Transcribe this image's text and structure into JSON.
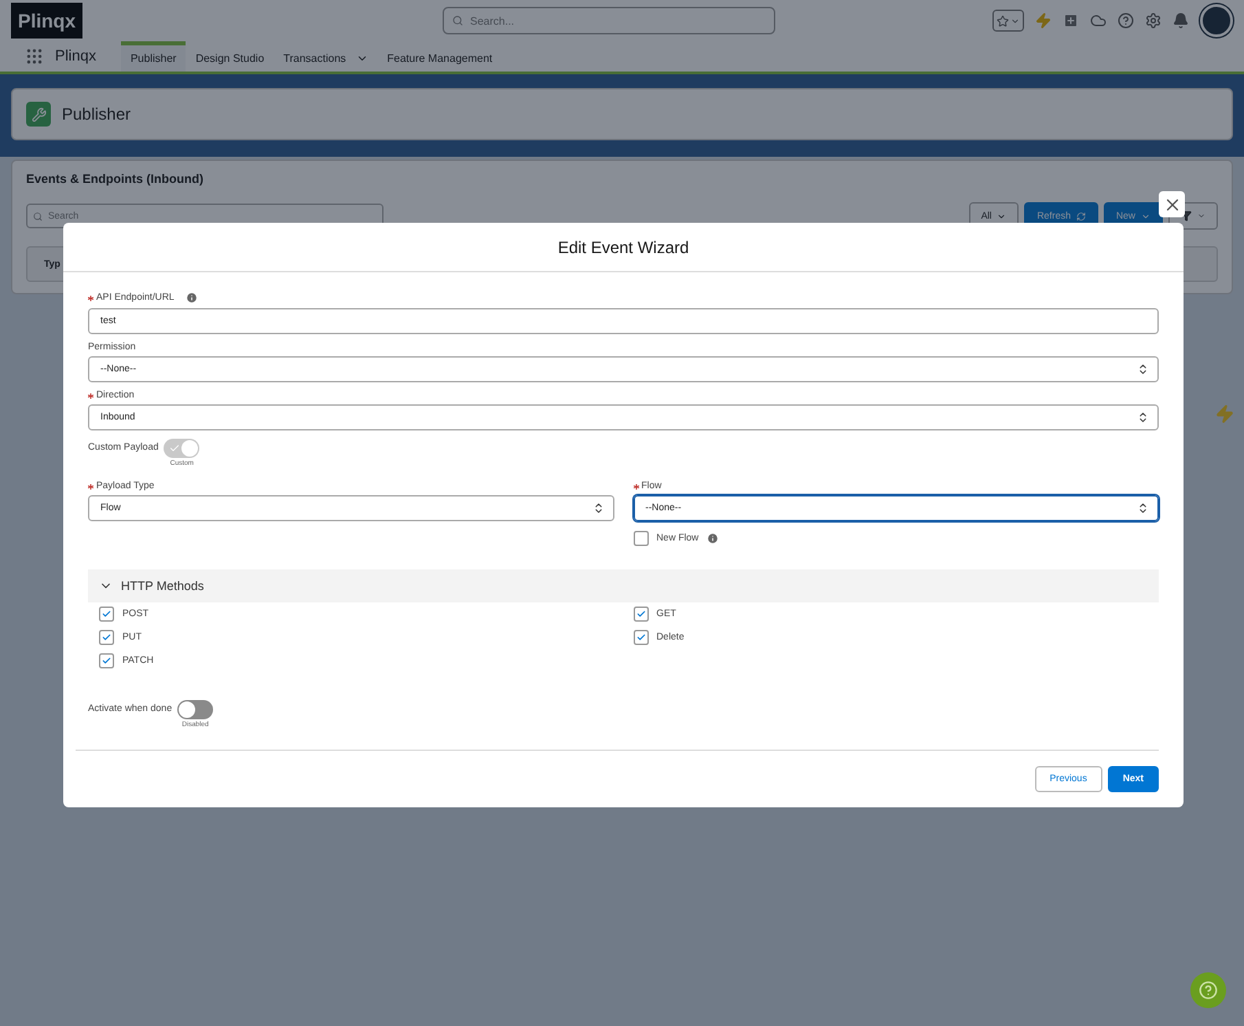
{
  "app_bar": {
    "logo": "Plinqx",
    "search": {
      "placeholder": "Search..."
    }
  },
  "nav": {
    "app_name": "Plinqx",
    "tabs": [
      {
        "label": "Publisher",
        "selected": true,
        "has_menu": false
      },
      {
        "label": "Design Studio",
        "selected": false,
        "has_menu": false
      },
      {
        "label": "Transactions",
        "selected": false,
        "has_menu": true
      },
      {
        "label": "Feature Management",
        "selected": false,
        "has_menu": false
      }
    ]
  },
  "page_header": {
    "title": "Publisher"
  },
  "list_card": {
    "title": "Events & Endpoints (Inbound)",
    "search": {
      "placeholder": "Search"
    },
    "filter": {
      "value": "All"
    },
    "buttons": [
      "Refresh",
      "New"
    ],
    "column_1": "Typ"
  },
  "modal": {
    "title": "Edit Event Wizard",
    "rows": [
      {
        "kind": "text",
        "label": "API Endpoint/URL",
        "required": true,
        "info": true,
        "value": "test"
      },
      {
        "kind": "select",
        "label": "Permission",
        "required": false,
        "info": false,
        "value": "--None--"
      },
      {
        "kind": "select",
        "label": "Direction",
        "required": true,
        "info": false,
        "value": "Inbound"
      },
      {
        "kind": "toggle",
        "label": "Custom Payload",
        "on": true,
        "state_label": "Custom"
      }
    ],
    "pair": [
      {
        "label": "Payload Type",
        "required": true,
        "value": "Flow",
        "focused": false
      },
      {
        "label": "Flow",
        "required": true,
        "value": "--None--",
        "focused": true
      }
    ],
    "new_flow": {
      "label": "New Flow",
      "checked": false,
      "info": true
    },
    "section": {
      "title": "HTTP Methods",
      "expanded": true,
      "methods": [
        {
          "label": "POST",
          "checked": true
        },
        {
          "label": "GET",
          "checked": true
        },
        {
          "label": "PUT",
          "checked": true
        },
        {
          "label": "Delete",
          "checked": true
        },
        {
          "label": "PATCH",
          "checked": true
        }
      ]
    },
    "activate": {
      "label": "Activate when done",
      "on": false,
      "state_label": "Disabled"
    },
    "buttons": [
      {
        "label": "Previous",
        "kind": "neutral"
      },
      {
        "label": "Next",
        "kind": "brand"
      }
    ]
  }
}
